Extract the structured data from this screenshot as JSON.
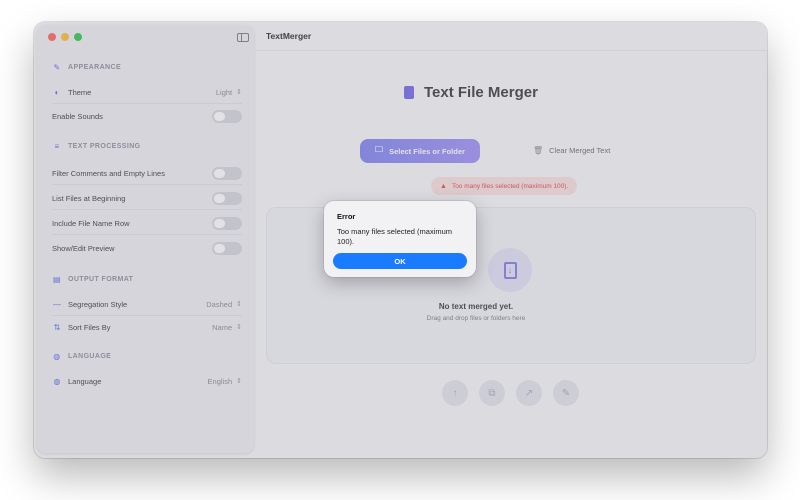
{
  "window": {
    "title": "TextMerger"
  },
  "sidebar": {
    "sections": [
      {
        "title": "APPEARANCE",
        "icon": "paintbrush-icon"
      },
      {
        "title": "TEXT PROCESSING",
        "icon": "list-icon"
      },
      {
        "title": "OUTPUT FORMAT",
        "icon": "document-icon"
      },
      {
        "title": "LANGUAGE",
        "icon": "globe-icon"
      }
    ],
    "theme": {
      "label": "Theme",
      "value": "Light"
    },
    "enable_sounds": {
      "label": "Enable Sounds",
      "on": false
    },
    "filter_comments": {
      "label": "Filter Comments and Empty Lines",
      "on": false
    },
    "list_files": {
      "label": "List Files at Beginning",
      "on": false
    },
    "include_file_name": {
      "label": "Include File Name Row",
      "on": false
    },
    "show_edit_preview": {
      "label": "Show/Edit Preview",
      "on": false
    },
    "segregation_style": {
      "label": "Segregation Style",
      "value": "Dashed"
    },
    "sort_files": {
      "label": "Sort Files By",
      "value": "Name"
    },
    "language": {
      "label": "Language",
      "value": "English"
    }
  },
  "main": {
    "title": "Text File Merger",
    "select_button": "Select Files or Folder",
    "clear_button": "Clear Merged Text",
    "error_badge": "Too many files selected (maximum 100).",
    "empty_title": "No text merged yet.",
    "empty_subtitle": "Drag and drop files or folders here"
  },
  "alert": {
    "title": "Error",
    "message": "Too many files selected (maximum 100).",
    "ok_label": "OK"
  },
  "colors": {
    "accent": "#5b63e6",
    "ok_button": "#1a7bff",
    "error": "#dd4444"
  }
}
